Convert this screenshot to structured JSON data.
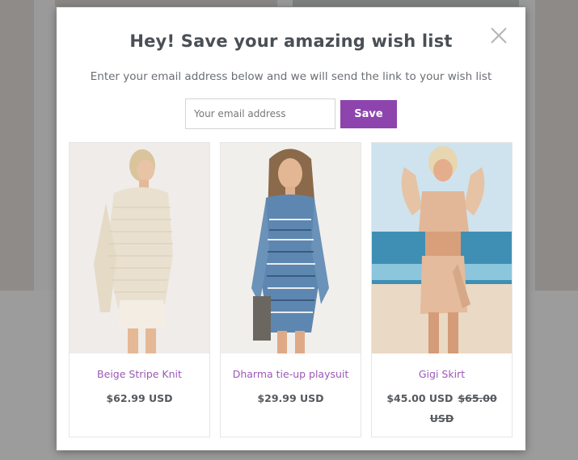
{
  "modal": {
    "title": "Hey! Save your amazing wish list",
    "subtitle": "Enter your email address below and we will send the link to your wish list",
    "email_placeholder": "Your email address",
    "save_label": "Save",
    "close_icon": "close-icon"
  },
  "products": [
    {
      "name": "Beige Stripe Knit",
      "price": "$62.99 USD",
      "compare_price": ""
    },
    {
      "name": "Dharma tie-up playsuit",
      "price": "$29.99 USD",
      "compare_price": ""
    },
    {
      "name": "Gigi Skirt",
      "price": "$45.00 USD",
      "compare_price": "$65.00 USD"
    }
  ],
  "colors": {
    "accent": "#8e44ad",
    "link": "#9b59b6",
    "title": "#4a4f55"
  }
}
